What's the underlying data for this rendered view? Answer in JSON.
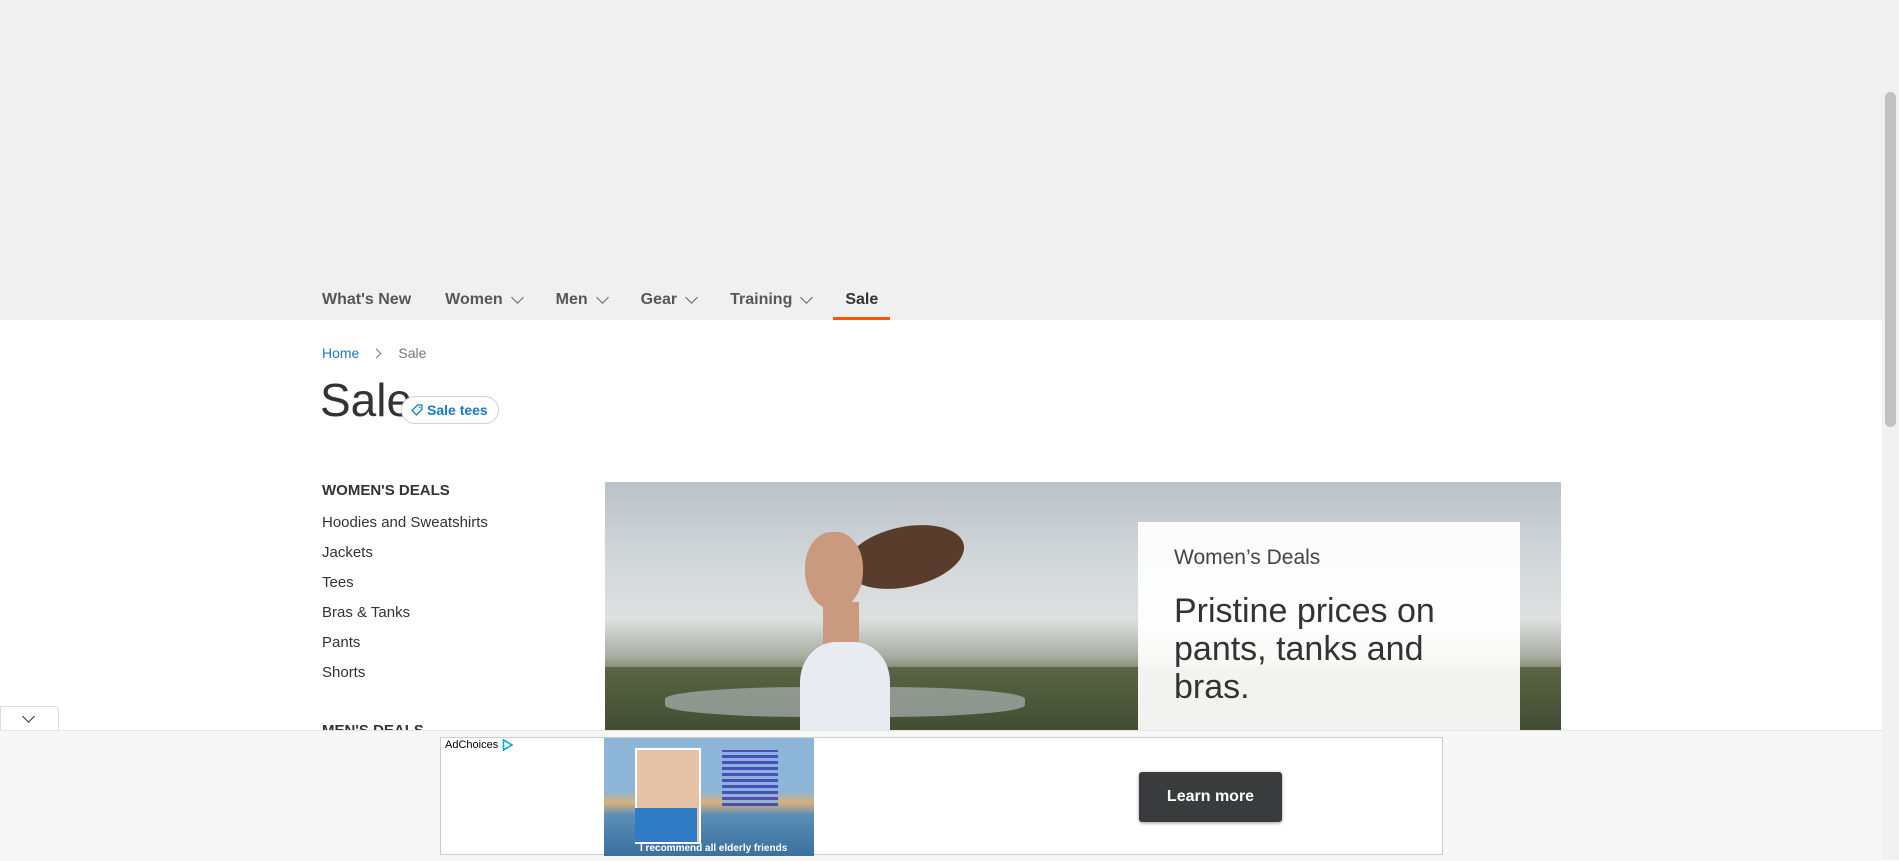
{
  "nav": {
    "items": [
      {
        "label": "What's New"
      },
      {
        "label": "Women"
      },
      {
        "label": "Men"
      },
      {
        "label": "Gear"
      },
      {
        "label": "Training"
      },
      {
        "label": "Sale"
      }
    ]
  },
  "breadcrumb": {
    "home": "Home",
    "current": "Sale"
  },
  "page": {
    "title": "Sale",
    "chip_label": "Sale tees"
  },
  "sidebar": {
    "women_heading": "WOMEN'S DEALS",
    "women_links": [
      "Hoodies and Sweatshirts",
      "Jackets",
      "Tees",
      "Bras & Tanks",
      "Pants",
      "Shorts"
    ],
    "men_heading": "MEN'S DEALS"
  },
  "hero": {
    "kicker": "Women’s Deals",
    "headline": "Pristine prices on pants, tanks and bras."
  },
  "ad": {
    "adchoices": "AdChoices",
    "caption": "I recommend all elderly friends",
    "cta": "Learn more"
  },
  "colors": {
    "accent": "#ff5501",
    "link": "#1979c3",
    "cta_bg": "#393b3d"
  }
}
